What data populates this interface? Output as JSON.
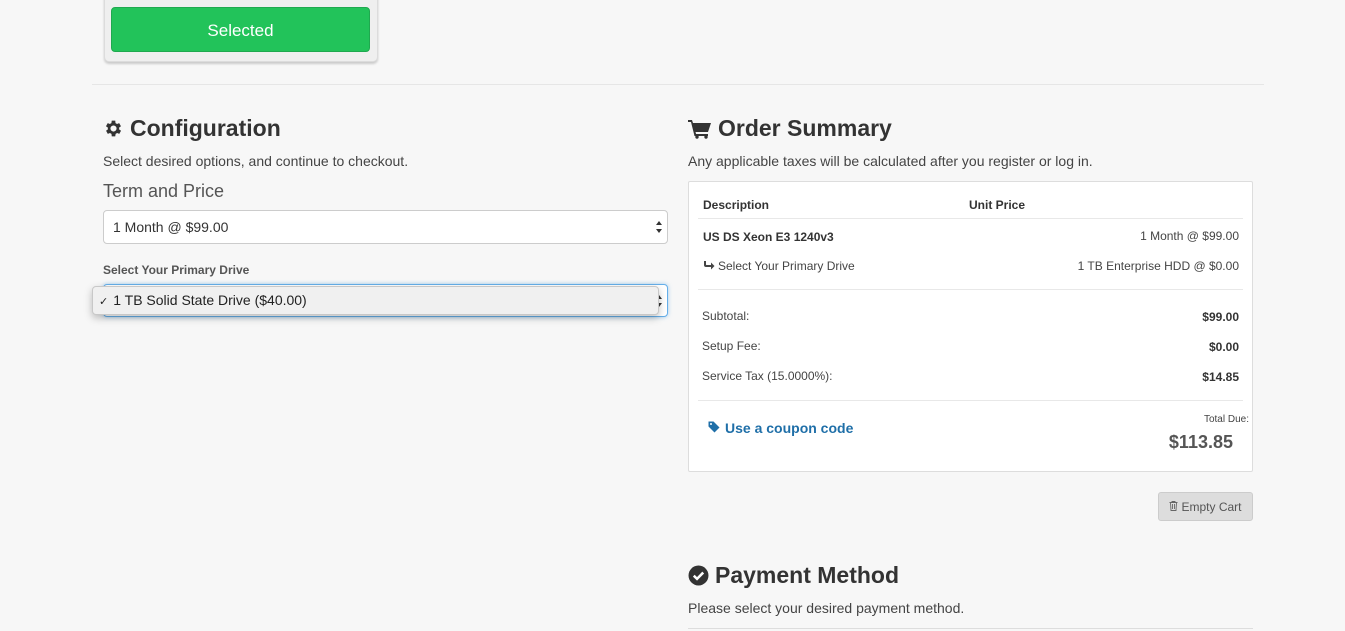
{
  "plan": {
    "selected_label": "Selected"
  },
  "configuration": {
    "title": "Configuration",
    "subtitle": "Select desired options, and continue to checkout.",
    "term_heading": "Term and Price",
    "term_value": "1 Month @ $99.00",
    "primary_drive_label": "Select Your Primary Drive",
    "primary_drive_dropdown": {
      "checkmark": "✓",
      "selected_option": "1 TB Solid State Drive ($40.00)"
    }
  },
  "order_summary": {
    "title": "Order Summary",
    "subtitle": "Any applicable taxes will be calculated after you register or log in.",
    "columns": [
      "Description",
      "Unit Price"
    ],
    "product_name": "US DS Xeon E3 1240v3",
    "product_price": "1 Month @ $99.00",
    "option_label": "Select Your Primary Drive",
    "option_value": "1 TB Enterprise HDD @ $0.00",
    "totals": [
      {
        "label": "Subtotal:",
        "value": "$99.00"
      },
      {
        "label": "Setup Fee:",
        "value": "$0.00"
      },
      {
        "label": "Service Tax (15.0000%):",
        "value": "$14.85"
      }
    ],
    "coupon_link": "Use a coupon code",
    "total_due_label": "Total Due:",
    "total_due_value": "$113.85",
    "empty_cart_label": "Empty Cart"
  },
  "payment": {
    "title": "Payment Method",
    "subtitle": "Please select your desired payment method."
  },
  "colors": {
    "selected_green": "#22c35a",
    "link_blue": "#1f6fa8",
    "focus_blue": "#66afe9"
  },
  "icons": {
    "configuration": "gear-icon",
    "order_summary": "shopping-cart-icon",
    "option_arrow": "share-arrow-icon",
    "coupon": "tag-icon",
    "empty_cart": "trash-icon",
    "payment": "check-circle-icon"
  }
}
